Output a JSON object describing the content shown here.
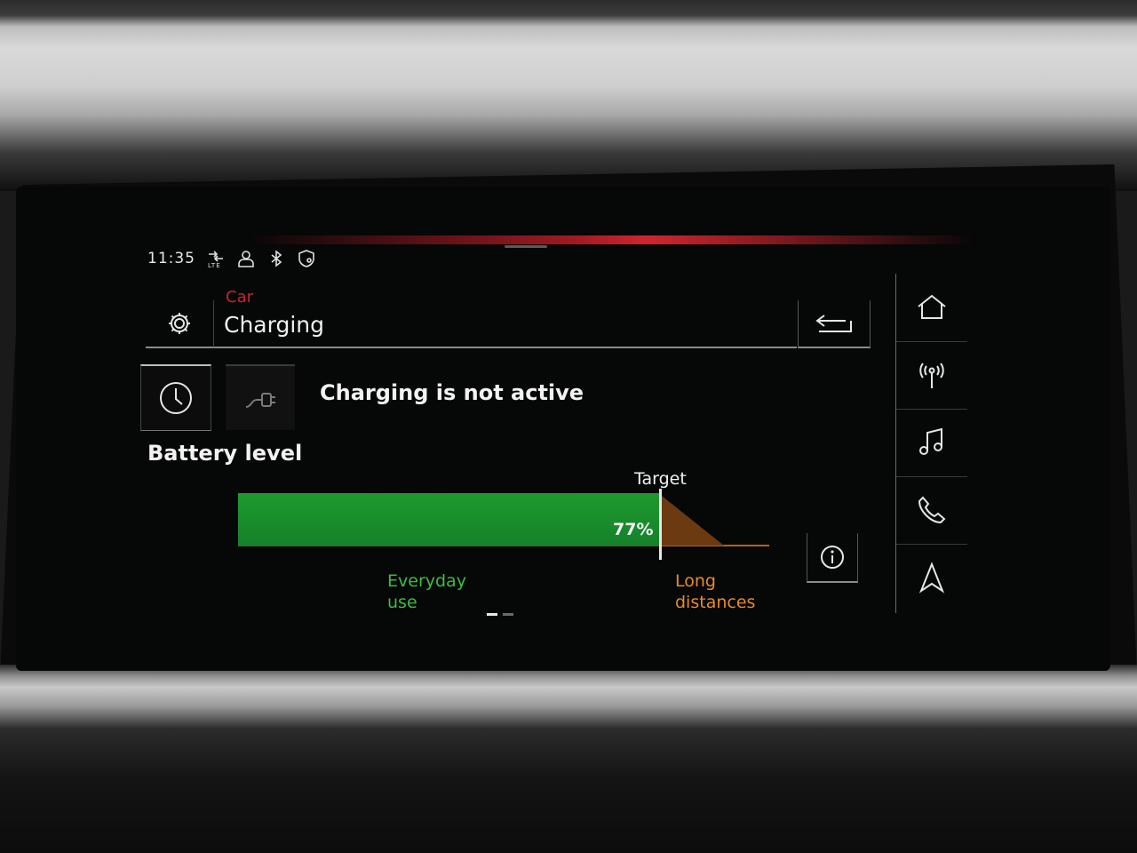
{
  "status_bar": {
    "time": "11:35",
    "icons": [
      "lte-signal-icon",
      "user-profile-icon",
      "bluetooth-icon",
      "location-shield-icon"
    ]
  },
  "header": {
    "breadcrumb": "Car",
    "title": "Charging",
    "settings_icon": "gear-icon",
    "back_icon": "back-arrow-icon"
  },
  "modes": [
    {
      "icon": "clock-icon",
      "selected": true
    },
    {
      "icon": "charging-plug-icon",
      "selected": false
    }
  ],
  "charging_status": "Charging is not active",
  "battery": {
    "label": "Battery level",
    "level_percent": 77,
    "level_text": "77%",
    "target_label": "Target",
    "everyday_label_line1": "Everyday",
    "everyday_label_line2": "use",
    "long_label_line1": "Long",
    "long_label_line2": "distances"
  },
  "pager": {
    "pages": 2,
    "active": 0
  },
  "nav_rail": [
    {
      "icon": "home-icon"
    },
    {
      "icon": "radio-icon"
    },
    {
      "icon": "music-note-icon"
    },
    {
      "icon": "phone-icon"
    },
    {
      "icon": "navigation-arrow-icon"
    }
  ],
  "colors": {
    "accent_red": "#c4262e",
    "battery_green": "#1f9a2f",
    "everyday_green": "#3bbf3f",
    "long_orange": "#e98a2a"
  }
}
